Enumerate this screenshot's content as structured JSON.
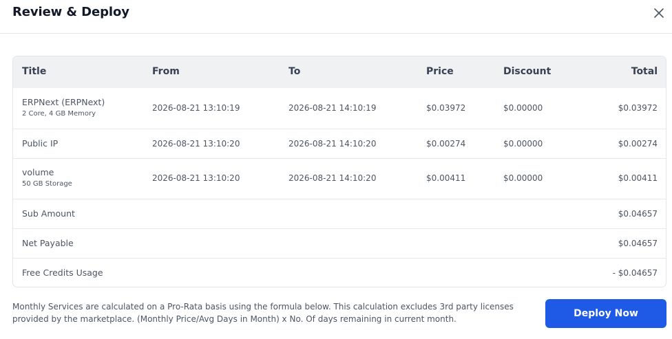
{
  "modal": {
    "title": "Review & Deploy",
    "close_icon": "close-icon"
  },
  "table": {
    "headers": {
      "title": "Title",
      "from": "From",
      "to": "To",
      "price": "Price",
      "discount": "Discount",
      "total": "Total"
    },
    "items": [
      {
        "title": "ERPNext (ERPNext)",
        "subtitle": "2 Core, 4 GB Memory",
        "from": "2026-08-21 13:10:19",
        "to": "2026-08-21 14:10:19",
        "price": "$0.03972",
        "discount": "$0.00000",
        "total": "$0.03972"
      },
      {
        "title": "Public IP",
        "subtitle": "",
        "from": "2026-08-21 13:10:20",
        "to": "2026-08-21 14:10:20",
        "price": "$0.00274",
        "discount": "$0.00000",
        "total": "$0.00274"
      },
      {
        "title": "volume",
        "subtitle": "50 GB Storage",
        "from": "2026-08-21 13:10:20",
        "to": "2026-08-21 14:10:20",
        "price": "$0.00411",
        "discount": "$0.00000",
        "total": "$0.00411"
      }
    ],
    "summary": [
      {
        "label": "Sub Amount",
        "value": "$0.04657"
      },
      {
        "label": "Net Payable",
        "value": "$0.04657"
      },
      {
        "label": "Free Credits Usage",
        "value": "- $0.04657"
      }
    ]
  },
  "footer": {
    "note_line1": "Monthly Services are calculated on a Pro-Rata basis using the formula below. This calculation excludes 3rd party licenses",
    "note_line2": "provided by the marketplace. (Monthly Price/Avg Days in Month) x No. Of days remaining in current month.",
    "deploy_label": "Deploy Now"
  },
  "colors": {
    "primary": "#1f5ae6",
    "header_bg": "#f0f1f3",
    "border": "#e2e5e9"
  }
}
